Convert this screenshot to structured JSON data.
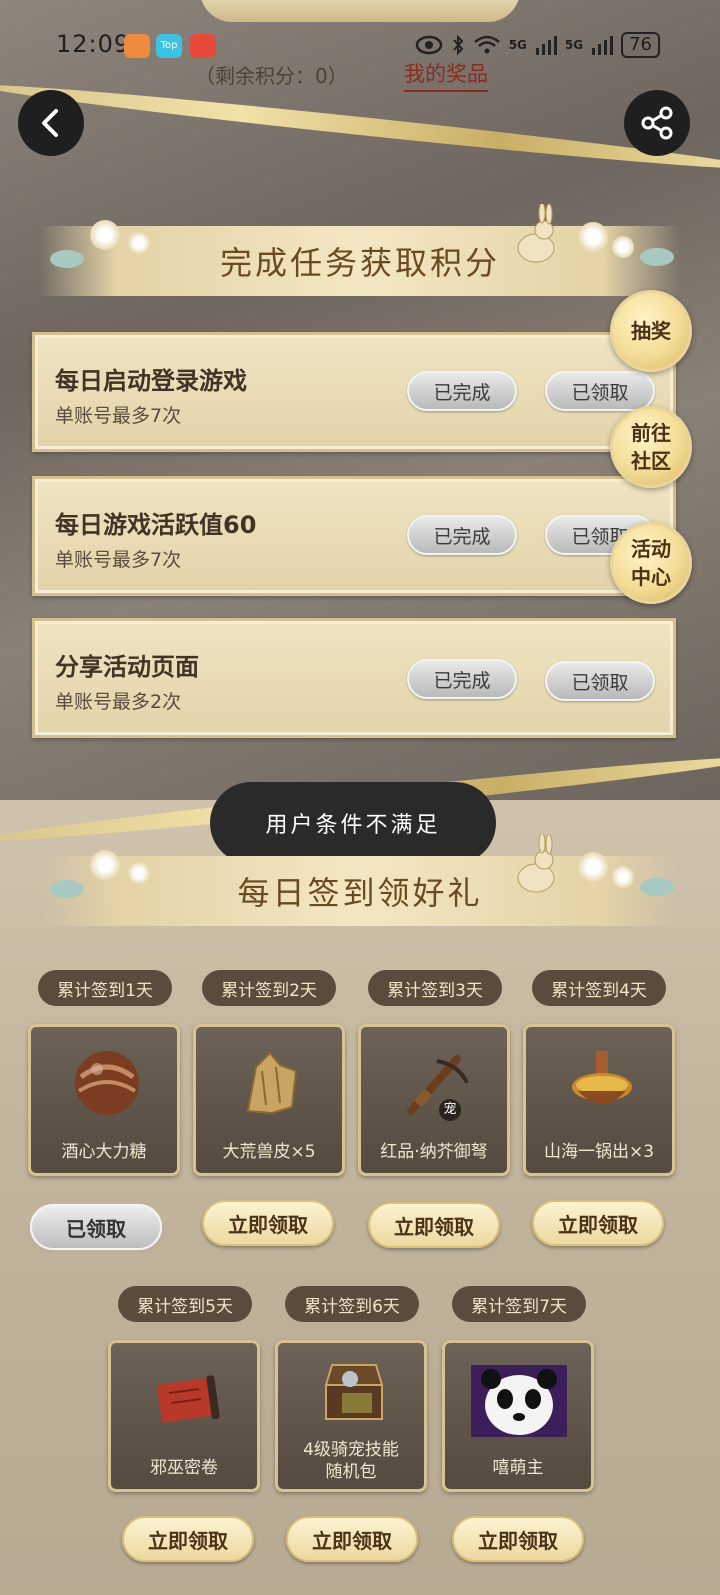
{
  "status_bar": {
    "time": "12:09",
    "battery": "76",
    "network": "5G"
  },
  "header": {
    "points_text": "（剩余积分：0）",
    "my_prizes": "我的奖品"
  },
  "tasks_section": {
    "title": "完成任务获取积分",
    "tasks": [
      {
        "title": "每日启动登录游戏",
        "limit": "单账号最多7次",
        "status": "已完成",
        "reward_status": "已领取"
      },
      {
        "title": "每日游戏活跃值60",
        "limit": "单账号最多7次",
        "status": "已完成",
        "reward_status": "已领取"
      },
      {
        "title": "分享活动页面",
        "limit": "单账号最多2次",
        "status": "已完成",
        "reward_status": "已领取"
      }
    ]
  },
  "side_buttons": {
    "lottery": "抽奖",
    "community_line1": "前往",
    "community_line2": "社区",
    "activity_line1": "活动",
    "activity_line2": "中心"
  },
  "toast": "用户条件不满足",
  "signin_section": {
    "title": "每日签到领好礼",
    "days": [
      {
        "label": "累计签到1天",
        "reward": "酒心大力糖",
        "button": "已领取"
      },
      {
        "label": "累计签到2天",
        "reward": "大荒兽皮×5",
        "button": "立即领取"
      },
      {
        "label": "累计签到3天",
        "reward": "红品·纳芥御弩",
        "button": "立即领取",
        "badge": "宠"
      },
      {
        "label": "累计签到4天",
        "reward": "山海一锅出×3",
        "button": "立即领取"
      },
      {
        "label": "累计签到5天",
        "reward": "邪巫密卷",
        "button": "立即领取"
      },
      {
        "label": "累计签到6天",
        "reward_line1": "4级骑宠技能",
        "reward_line2": "随机包",
        "button": "立即领取"
      },
      {
        "label": "累计签到7天",
        "reward": "嘻萌主",
        "button": "立即领取"
      }
    ]
  }
}
